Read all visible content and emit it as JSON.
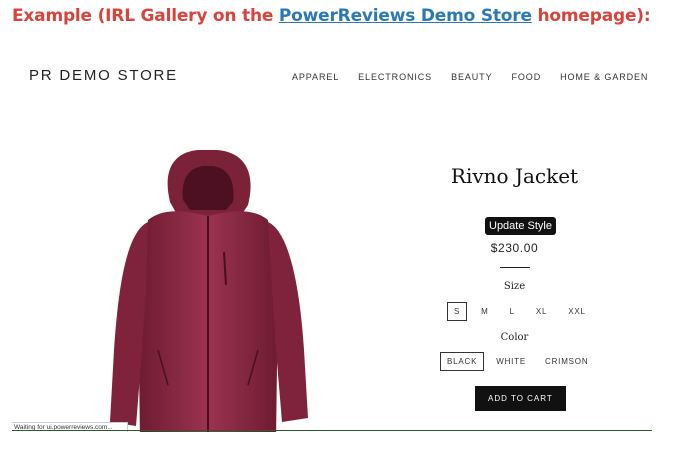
{
  "caption": {
    "prefix": "Example (IRL Gallery on the ",
    "link": "PowerReviews Demo Store",
    "suffix": " homepage):"
  },
  "header": {
    "store_name": "PR DEMO STORE",
    "nav": [
      "APPAREL",
      "ELECTRONICS",
      "BEAUTY",
      "FOOD",
      "HOME & GARDEN"
    ]
  },
  "product": {
    "title": "Rivno Jacket",
    "update_style_label": "Update Style",
    "price": "$230.00",
    "size_label": "Size",
    "sizes": [
      "S",
      "M",
      "L",
      "XL",
      "XXL"
    ],
    "selected_size": "S",
    "color_label": "Color",
    "colors": [
      "BLACK",
      "WHITE",
      "CRIMSON"
    ],
    "selected_color": "BLACK",
    "add_to_cart_label": "ADD TO CART",
    "jacket_color": "#8e2c44"
  },
  "status_text": "Waiting for ui.powerreviews.com..."
}
